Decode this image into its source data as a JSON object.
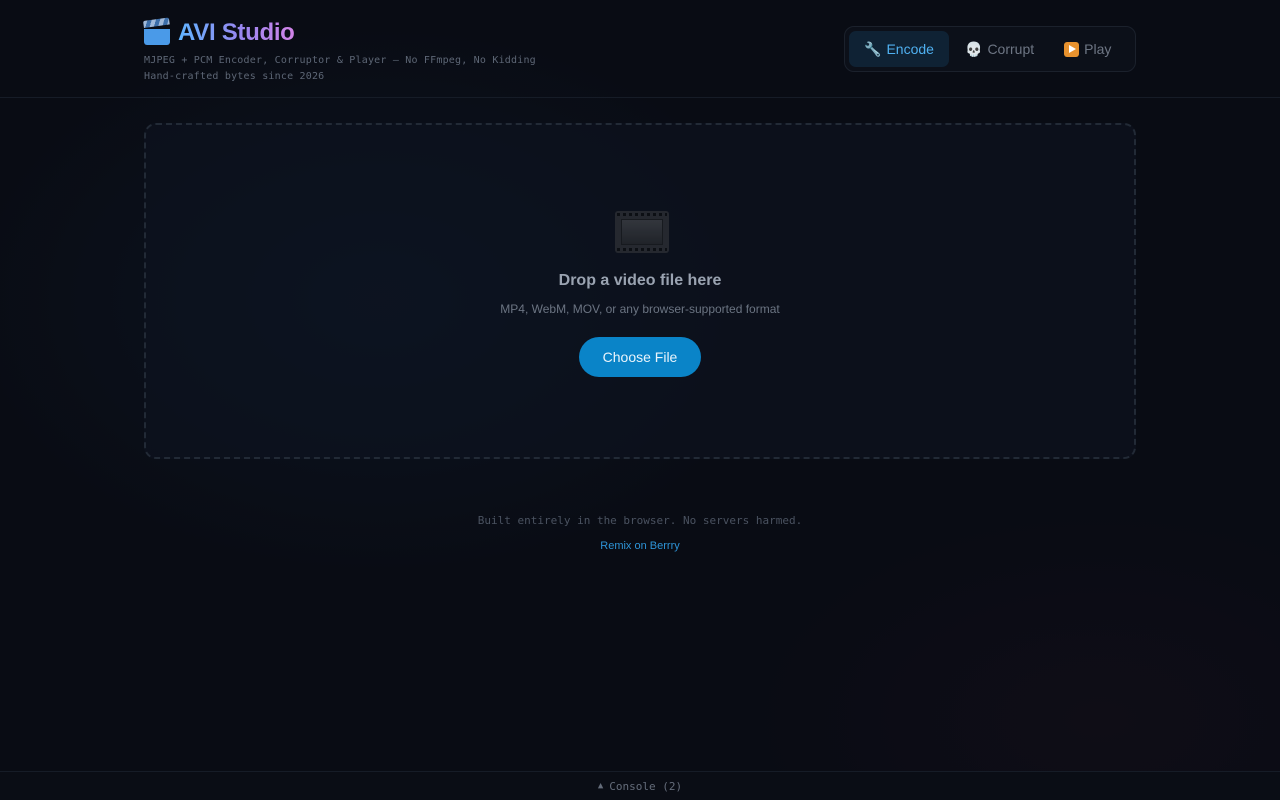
{
  "header": {
    "title": "AVI Studio",
    "logo_icon": "clapperboard-icon",
    "subtitle_line1": "MJPEG + PCM Encoder, Corruptor & Player — No FFmpeg, No Kidding",
    "subtitle_line2": "Hand-crafted bytes since 2026"
  },
  "tabs": [
    {
      "label": "Encode",
      "icon": "wrench-icon",
      "active": true
    },
    {
      "label": "Corrupt",
      "icon": "skull-icon",
      "active": false
    },
    {
      "label": "Play",
      "icon": "play-icon",
      "active": false
    }
  ],
  "dropzone": {
    "icon": "film-frames-icon",
    "title": "Drop a video file here",
    "subtitle": "MP4, WebM, MOV, or any browser-supported format",
    "button_label": "Choose File"
  },
  "footer": {
    "note": "Built entirely in the browser. No servers harmed.",
    "remix_link": "Remix on Berrry"
  },
  "console": {
    "label": "Console (2)",
    "toggle_icon": "triangle-up-icon"
  },
  "colors": {
    "background": "#090c14",
    "accent": "#0a84c8",
    "active_tab_text": "#4fb0f0",
    "link": "#2d93d6"
  }
}
